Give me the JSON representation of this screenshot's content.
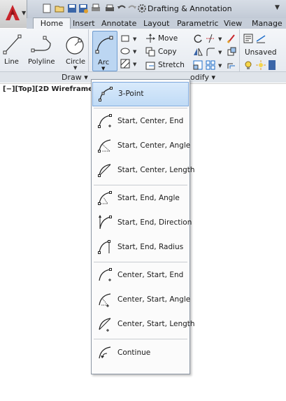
{
  "app": {
    "workspace": "Drafting & Annotation",
    "viewport_label": "[−][Top][2D Wireframe]"
  },
  "ribbon_tabs": [
    "Home",
    "Insert",
    "Annotate",
    "Layout",
    "Parametric",
    "View",
    "Manage"
  ],
  "ribbon": {
    "line": "Line",
    "polyline": "Polyline",
    "circle": "Circle",
    "arc": "Arc",
    "move": "Move",
    "copy": "Copy",
    "stretch": "Stretch",
    "unsaved": "Unsaved",
    "draw_panel": "Draw ▾",
    "modify_panel": "odify ▾"
  },
  "arc_menu": {
    "items": [
      {
        "label": "3-Point",
        "icon": "arc-3point-icon",
        "selected": true
      },
      {
        "label": "Start, Center, End",
        "icon": "arc-start-center-end-icon"
      },
      {
        "label": "Start, Center, Angle",
        "icon": "arc-start-center-angle-icon"
      },
      {
        "label": "Start, Center, Length",
        "icon": "arc-start-center-length-icon"
      },
      {
        "label": "Start, End, Angle",
        "icon": "arc-start-end-angle-icon"
      },
      {
        "label": "Start, End, Direction",
        "icon": "arc-start-end-direction-icon"
      },
      {
        "label": "Start, End, Radius",
        "icon": "arc-start-end-radius-icon"
      },
      {
        "label": "Center, Start, End",
        "icon": "arc-center-start-end-icon"
      },
      {
        "label": "Center, Start, Angle",
        "icon": "arc-center-start-angle-icon"
      },
      {
        "label": "Center, Start, Length",
        "icon": "arc-center-start-length-icon"
      },
      {
        "label": "Continue",
        "icon": "arc-continue-icon"
      }
    ]
  },
  "colors": {
    "accent_red": "#c8262c",
    "selected_bg": "#c0dbf6",
    "ribbon_bg": "#e2e7ee"
  }
}
